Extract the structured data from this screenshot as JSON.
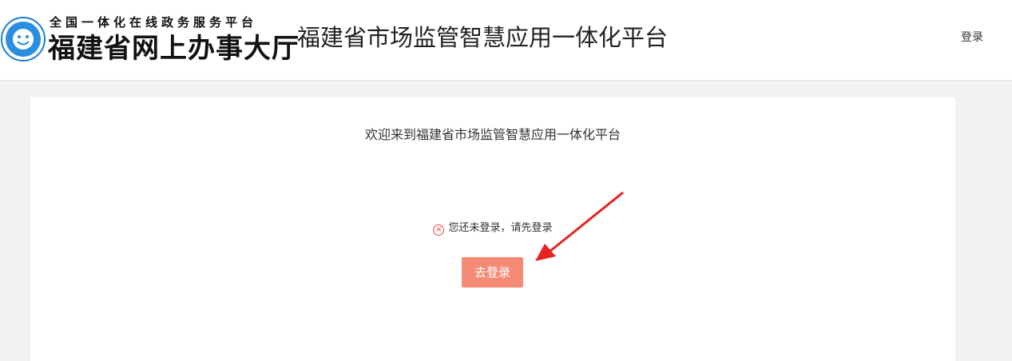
{
  "header": {
    "logo": {
      "small_text": "全国一体化在线政务服务平台",
      "big_text": "福建省网上办事大厅"
    },
    "platform_title": "福建省市场监管智慧应用一体化平台",
    "login_link": "登录"
  },
  "main": {
    "welcome_text": "欢迎来到福建省市场监管智慧应用一体化平台",
    "notice_text": "您还未登录，请先登录",
    "go_login_button": "去登录"
  },
  "colors": {
    "page_bg": "#f2f2f2",
    "button_bg": "#f58b76",
    "notice_icon": "#e84b4b",
    "arrow": "#e8231f"
  },
  "icons": {
    "logo_emblem": "smiley-emblem-icon",
    "notice_icon": "close-circle-icon",
    "annotation_arrow": "red-arrow-icon"
  }
}
